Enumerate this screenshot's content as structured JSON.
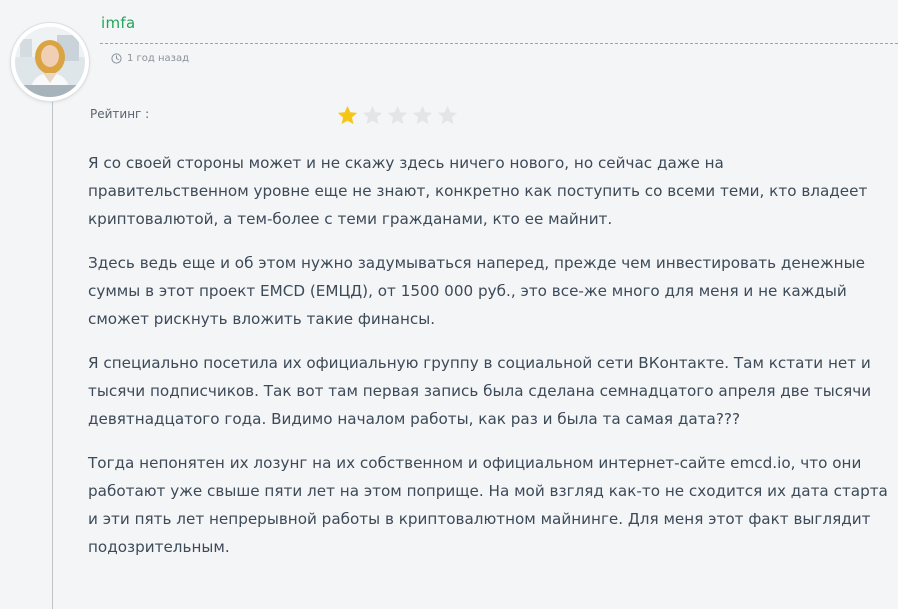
{
  "comment": {
    "author": "imfa",
    "time_ago": "1 год назад",
    "rating_label": "Рейтинг :",
    "rating": {
      "value": 1,
      "max": 5
    },
    "paragraphs": [
      "Я со своей стороны может и не скажу здесь ничего нового, но сейчас даже на правительственном уровне еще не знают, конкретно как поступить со всеми теми, кто владеет криптовалютой, а тем-более с теми гражданами, кто ее майнит.",
      "Здесь ведь еще и об этом нужно задумываться наперед, прежде чем инвестировать денежные суммы в этот проект EMCD (ЕМЦД), от 1500 000 руб., это все-же много для меня и не каждый сможет рискнуть вложить такие финансы.",
      "Я специально посетила их официальную группу в социальной сети ВКонтакте. Там кстати нет и тысячи подписчиков. Так вот там первая запись была сделана семнадцатого апреля две тысячи девятнадцатого года. Видимо началом работы, как раз и была та самая дата???",
      "Тогда непонятен их лозунг на их собственном и официальном интернет-сайте emcd.io, что они работают уже свыше пяти лет на этом поприще. На мой взгляд как-то не сходится их дата старта и эти пять лет непрерывной работы в криптовалютном майнинге. Для меня этот факт выглядит подозрительным."
    ]
  },
  "colors": {
    "author": "#22a55a",
    "divider": "#5ec88e",
    "star_active": "#f5c518",
    "star_inactive": "#e3e5e8",
    "text": "#3d4a58",
    "background": "#f4f5f7"
  },
  "icons": {
    "time": "clock-icon",
    "rating": "star-icon",
    "avatar": "user-avatar"
  }
}
